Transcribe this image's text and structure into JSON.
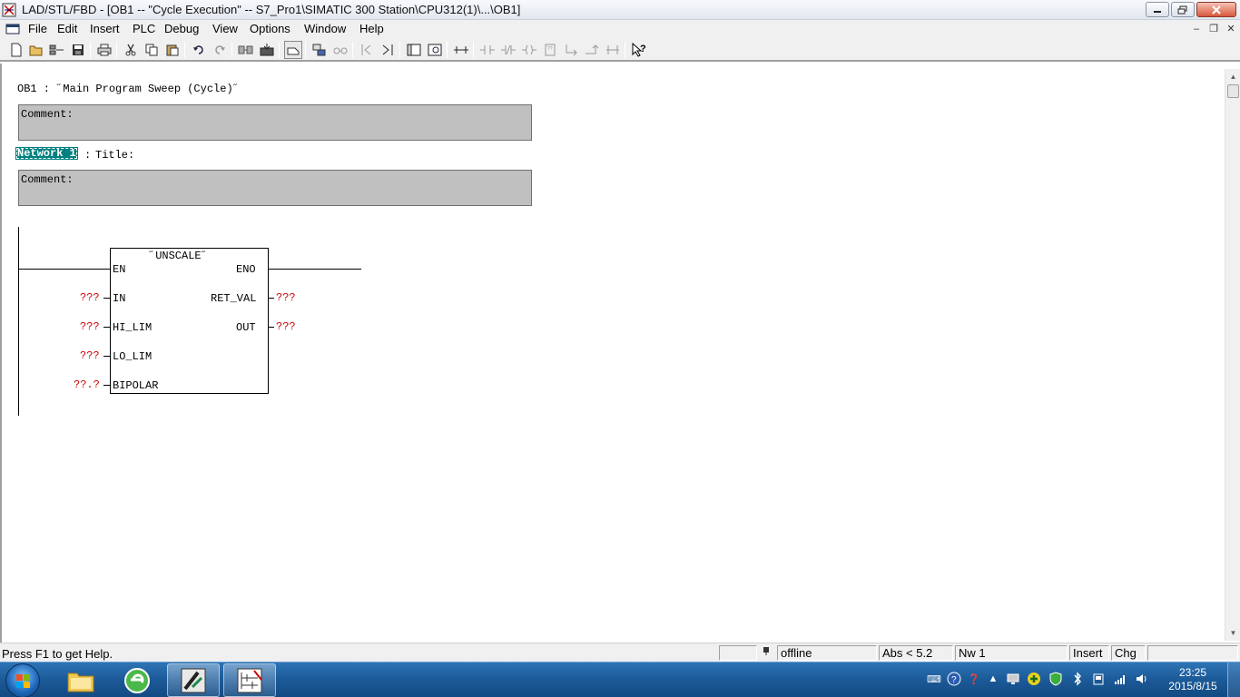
{
  "window": {
    "title": "LAD/STL/FBD  - [OB1 -- \"Cycle Execution\" -- S7_Pro1\\SIMATIC 300 Station\\CPU312(1)\\...\\OB1]"
  },
  "menu": {
    "items": [
      "File",
      "Edit",
      "Insert",
      "PLC",
      "Debug",
      "View",
      "Options",
      "Window",
      "Help"
    ]
  },
  "editor": {
    "ob_header": "OB1 :  ˝Main Program Sweep (Cycle)˝",
    "block_comment_label": "Comment:",
    "network_label": "Network 1",
    "network_colon": ":",
    "network_title": "Title:",
    "network_comment_label": "Comment:"
  },
  "function_block": {
    "name": "˝UNSCALE˝",
    "inputs": [
      "EN",
      "IN",
      "HI_LIM",
      "LO_LIM",
      "BIPOLAR"
    ],
    "outputs": [
      "ENO",
      "RET_VAL",
      "OUT"
    ],
    "input_params": [
      "???",
      "???",
      "???",
      "??.?"
    ],
    "output_params": [
      "???",
      "???"
    ]
  },
  "statusbar": {
    "help": "Press F1 to get Help.",
    "mode": "offline",
    "position": "Abs < 5.2",
    "network": "Nw 1",
    "insert": "Insert",
    "chg": "Chg"
  },
  "taskbar": {
    "time": "23:25",
    "date": "2015/8/15"
  },
  "colors": {
    "network_highlight": "#008080",
    "unset_param": "#d00000",
    "comment_bg": "#c0c0c0"
  }
}
